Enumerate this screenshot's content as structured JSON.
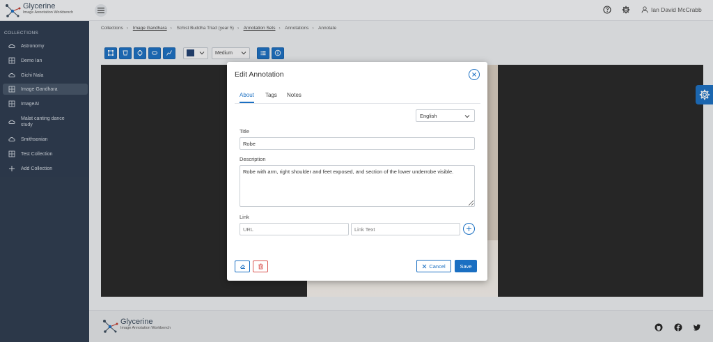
{
  "app": {
    "name": "Glycerine",
    "subtitle": "Image Annotation Workbench",
    "user_name": "Ian David McCrabb"
  },
  "sidebar": {
    "heading": "COLLECTIONS",
    "items": [
      {
        "label": "Astronomy",
        "icon": "cloud-icon"
      },
      {
        "label": "Demo Ian",
        "icon": "grid-icon"
      },
      {
        "label": "Gichi Nala",
        "icon": "cloud-icon"
      },
      {
        "label": "Image Gandhara",
        "icon": "grid-icon"
      },
      {
        "label": "ImageAI",
        "icon": "grid-icon"
      },
      {
        "label": "Malat canting dance study",
        "icon": "cloud-icon"
      },
      {
        "label": "Smithsonian",
        "icon": "cloud-icon"
      },
      {
        "label": "Test Collection",
        "icon": "grid-icon"
      },
      {
        "label": "Add Collection",
        "icon": "plus-icon"
      }
    ]
  },
  "breadcrumbs": [
    {
      "label": "Collections",
      "link": false
    },
    {
      "label": "Image Gandhara",
      "link": true
    },
    {
      "label": "Schist Buddha Triad (year 5)",
      "link": false
    },
    {
      "label": "Annotation Sets",
      "link": true
    },
    {
      "label": "Annotations",
      "link": false
    },
    {
      "label": "Annotate",
      "link": false
    }
  ],
  "toolbar": {
    "stroke_color": "#1f3f70",
    "stroke_size": "Medium"
  },
  "modal": {
    "title": "Edit Annotation",
    "tabs": [
      "About",
      "Tags",
      "Notes"
    ],
    "active_tab": "About",
    "language": "English",
    "title_label": "Title",
    "title_value": "Robe",
    "description_label": "Description",
    "description_value": "Robe with arm, right shoulder and feet exposed, and section of the lower underrobe visible.",
    "link_label": "Link",
    "url_placeholder": "URL",
    "link_text_placeholder": "Link Text",
    "cancel_label": "Cancel",
    "save_label": "Save"
  },
  "colors": {
    "primary": "#1a6fc2",
    "sidebar_bg": "#2c3a4e",
    "danger": "#d9534f"
  }
}
